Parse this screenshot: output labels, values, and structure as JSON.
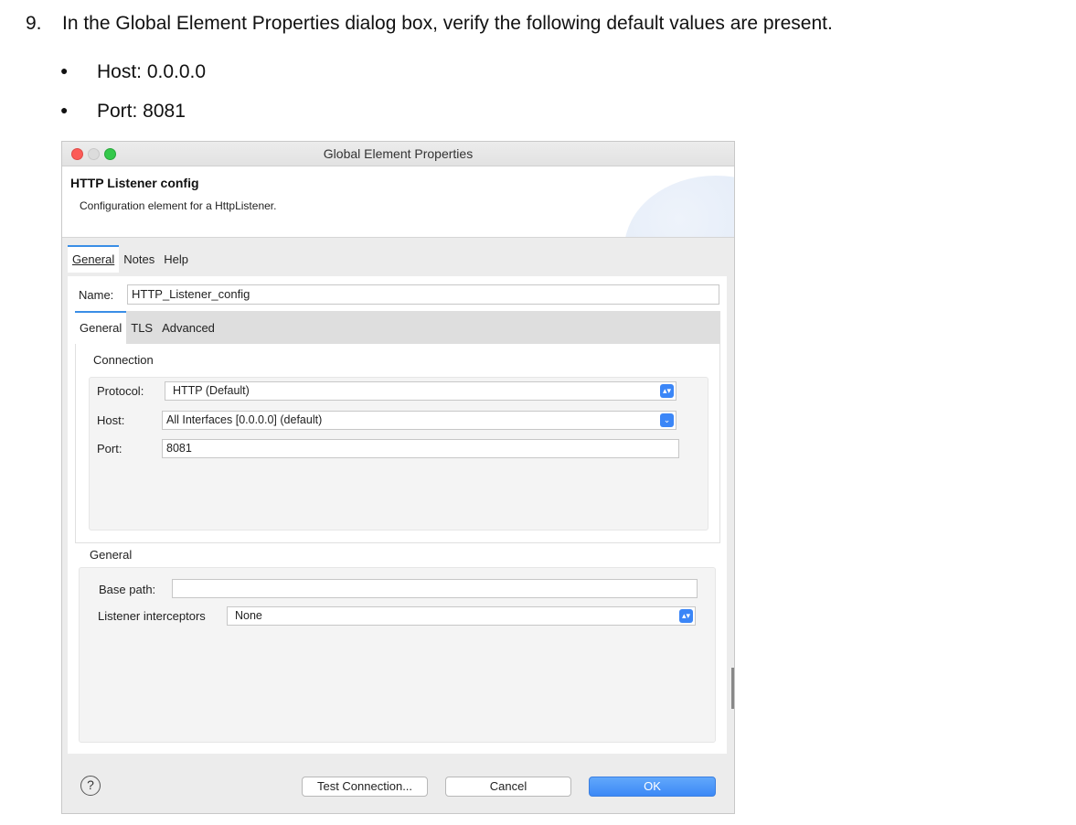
{
  "instructions": {
    "step_number": "9.",
    "step_text": "In the Global Element Properties dialog box, verify the following default values are present.",
    "bullets": [
      "Host: 0.0.0.0",
      "Port: 8081"
    ],
    "bullet_glyph": "●"
  },
  "dialog": {
    "title": "Global Element Properties",
    "heading": "HTTP Listener config",
    "description": "Configuration element for a HttpListener.",
    "tabs": [
      "General",
      "Notes",
      "Help"
    ],
    "name_label": "Name:",
    "name_value": "HTTP_Listener_config",
    "inner_tabs": [
      "General",
      "TLS",
      "Advanced"
    ],
    "connection": {
      "group_label": "Connection",
      "protocol_label": "Protocol:",
      "protocol_value": "HTTP (Default)",
      "host_label": "Host:",
      "host_value": "All Interfaces [0.0.0.0] (default)",
      "port_label": "Port:",
      "port_value": "8081"
    },
    "general": {
      "group_label": "General",
      "base_path_label": "Base path:",
      "base_path_value": "",
      "interceptors_label": "Listener interceptors",
      "interceptors_value": "None"
    },
    "buttons": {
      "help": "?",
      "test_connection": "Test Connection...",
      "cancel": "Cancel",
      "ok": "OK"
    },
    "accent_color": "#3b88f6"
  }
}
